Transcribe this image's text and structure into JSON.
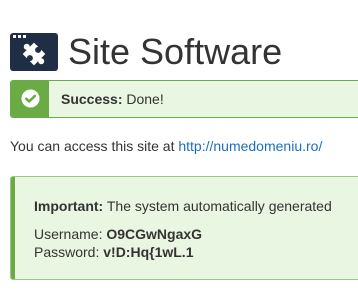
{
  "header": {
    "title": "Site Software",
    "icon": "puzzle-piece-icon"
  },
  "success_alert": {
    "label": "Success:",
    "message": "Done!",
    "icon": "check-circle-icon"
  },
  "access": {
    "prefix": "You can access this site at",
    "url": "http://numedomeniu.ro/"
  },
  "important_alert": {
    "label": "Important:",
    "message": "The system automatically generated",
    "username_label": "Username:",
    "username": "O9CGwNgaxG",
    "password_label": "Password:",
    "password": "v!D:Hq{1wL.1"
  },
  "colors": {
    "success_green": "#6aab45",
    "alert_background": "#e9f6e1",
    "link_blue": "#1d6fbd",
    "icon_navy": "#1f2d45"
  }
}
